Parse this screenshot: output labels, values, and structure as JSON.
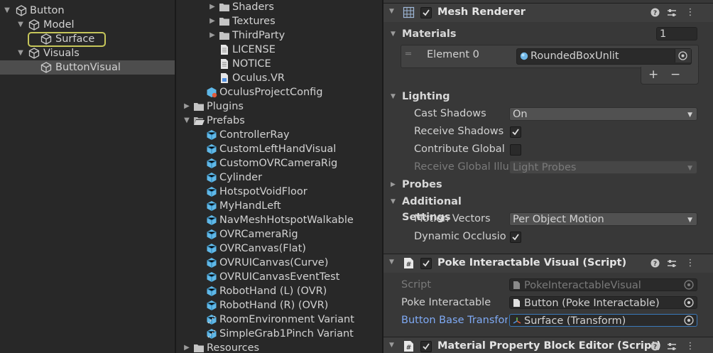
{
  "hierarchy": {
    "items": [
      {
        "label": "Button",
        "expanded": true
      },
      {
        "label": "Model",
        "expanded": true
      },
      {
        "label": "Surface"
      },
      {
        "label": "Visuals",
        "expanded": true
      },
      {
        "label": "ButtonVisual"
      }
    ]
  },
  "project": {
    "items": [
      {
        "label": "Shaders",
        "type": "folder"
      },
      {
        "label": "Textures",
        "type": "folder"
      },
      {
        "label": "ThirdParty",
        "type": "folder"
      },
      {
        "label": "LICENSE",
        "type": "doc"
      },
      {
        "label": "NOTICE",
        "type": "doc"
      },
      {
        "label": "Oculus.VR",
        "type": "dll"
      },
      {
        "label": "OculusProjectConfig",
        "type": "asset"
      },
      {
        "label": "Plugins",
        "type": "folder"
      },
      {
        "label": "Prefabs",
        "type": "folder-open"
      },
      {
        "label": "ControllerRay",
        "type": "prefab"
      },
      {
        "label": "CustomLeftHandVisual",
        "type": "prefab"
      },
      {
        "label": "CustomOVRCameraRig",
        "type": "prefab"
      },
      {
        "label": "Cylinder",
        "type": "prefab"
      },
      {
        "label": "HotspotVoidFloor",
        "type": "prefab"
      },
      {
        "label": "MyHandLeft",
        "type": "prefab"
      },
      {
        "label": "NavMeshHotspotWalkable",
        "type": "prefab"
      },
      {
        "label": "OVRCameraRig",
        "type": "prefab"
      },
      {
        "label": "OVRCanvas(Flat)",
        "type": "prefab"
      },
      {
        "label": "OVRUICanvas(Curve)",
        "type": "prefab"
      },
      {
        "label": "OVRUICanvasEventTest",
        "type": "prefab"
      },
      {
        "label": "RobotHand (L) (OVR)",
        "type": "prefab"
      },
      {
        "label": "RobotHand (R) (OVR)",
        "type": "prefab"
      },
      {
        "label": "RoomEnvironment Variant",
        "type": "variant"
      },
      {
        "label": "SimpleGrab1Pinch Variant",
        "type": "variant"
      },
      {
        "label": "Resources",
        "type": "folder"
      }
    ]
  },
  "inspector": {
    "mesh_renderer": {
      "title": "Mesh Renderer",
      "materials_label": "Materials",
      "materials_count": "1",
      "element_label": "Element 0",
      "element_value": "RoundedBoxUnlit",
      "plus": "+",
      "minus": "−",
      "lighting_label": "Lighting",
      "cast_shadows_label": "Cast Shadows",
      "cast_shadows_value": "On",
      "receive_shadows_label": "Receive Shadows",
      "contribute_gi_label": "Contribute Global",
      "receive_gi_label": "Receive Global Illu",
      "receive_gi_value": "Light Probes",
      "probes_label": "Probes",
      "additional_label": "Additional Settings",
      "motion_vectors_label": "Motion Vectors",
      "motion_vectors_value": "Per Object Motion",
      "dynamic_occlusion_label": "Dynamic Occlusio"
    },
    "poke_visual": {
      "title": "Poke Interactable Visual (Script)",
      "script_label": "Script",
      "script_value": "PokeInteractableVisual",
      "poke_label": "Poke Interactable",
      "poke_value": "Button (Poke Interactable)",
      "base_label": "Button Base Transfor",
      "base_value": "Surface (Transform)"
    },
    "mpb_editor": {
      "title": "Material Property Block Editor (Script)"
    }
  },
  "colors": {
    "selection_outline": "#c6c65a",
    "prefab_blue": "#5fb8e8",
    "link_blue": "#7faaf5",
    "focus_blue": "#3a79bb"
  }
}
